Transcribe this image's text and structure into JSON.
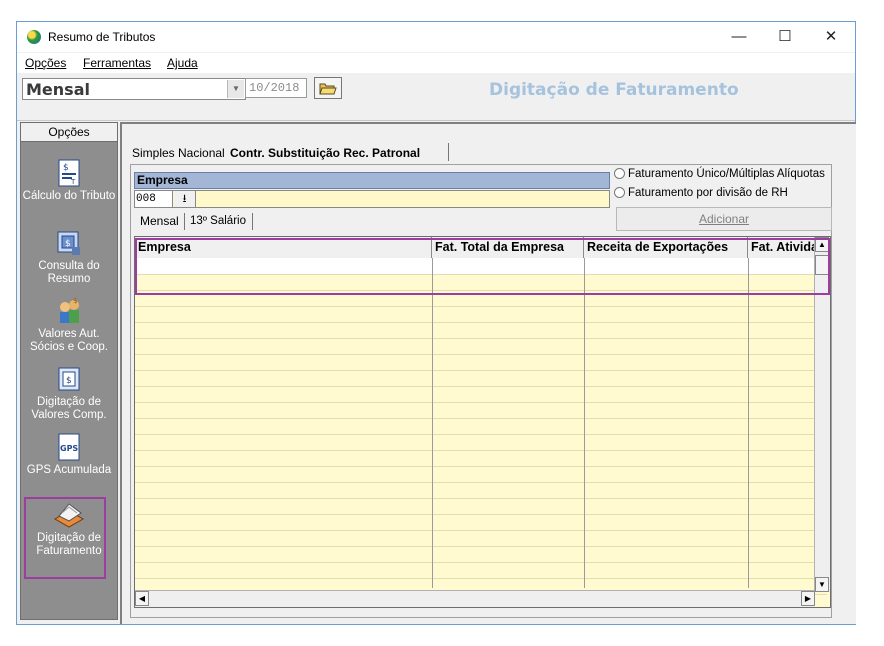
{
  "window": {
    "title": "Resumo de Tributos",
    "controls": {
      "minimize": "—",
      "maximize": "☐",
      "close": "✕"
    }
  },
  "menu": [
    "Opções",
    "Ferramentas",
    "Ajuda"
  ],
  "toolbar": {
    "mode_value": "Mensal",
    "period_value": "10/2018",
    "page_title": "Digitação de Faturamento"
  },
  "sidebar": {
    "header": "Opções",
    "items": [
      {
        "label": "Cálculo do Tributo",
        "icon": "calculation-document-icon"
      },
      {
        "label": "Consulta do Resumo",
        "icon": "summary-query-icon"
      },
      {
        "label": "Valores Aut. Sócios e Coop.",
        "icon": "partners-values-icon"
      },
      {
        "label": "Digitação de Valores Comp.",
        "icon": "values-entry-icon"
      },
      {
        "label": "GPS Acumulada",
        "icon": "gps-document-icon"
      },
      {
        "label": "Digitação de Faturamento",
        "icon": "billing-entry-icon",
        "selected": true
      }
    ]
  },
  "tabs": [
    "Simples Nacional",
    "Contr. Substituição Rec. Patronal"
  ],
  "active_tab": "Contr. Substituição Rec. Patronal",
  "empresa": {
    "header": "Empresa",
    "code": "008",
    "name": ""
  },
  "options": {
    "radio1": "Faturamento Único/Múltiplas Alíquotas",
    "radio2": "Faturamento por divisão de RH",
    "add_button": "Adicionar"
  },
  "subtabs": [
    "Mensal",
    "13º Salário"
  ],
  "grid": {
    "columns": [
      "Empresa",
      "Fat. Total da Empresa",
      "Receita de Exportações",
      "Fat. Atividade"
    ],
    "rows": []
  },
  "colors": {
    "highlight": "#9b3ea0",
    "grid_bg": "#fffad0",
    "title": "#a6c3de"
  }
}
